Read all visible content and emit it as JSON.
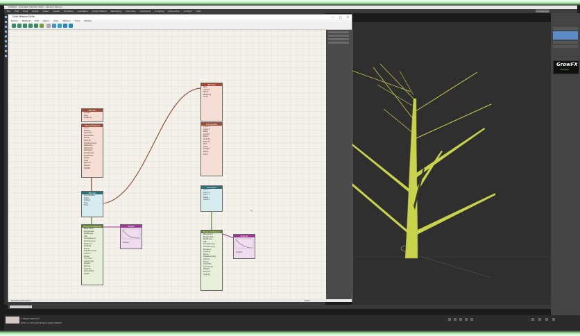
{
  "app": {
    "title": "Untitled - Autodesk 3ds Max 2021 - Student Version",
    "menus": [
      "File",
      "Edit",
      "Tools",
      "Group",
      "Views",
      "Create",
      "Modifiers",
      "Animation",
      "Graph Editors",
      "Rendering",
      "Civil View",
      "Customize",
      "Scripting",
      "Interactive",
      "Content",
      "Help"
    ],
    "workspace": "Workspaces"
  },
  "sme": {
    "title": "Slate Material Editor",
    "menus": [
      "Modes",
      "Material",
      "Edit",
      "Select",
      "View",
      "Options",
      "Tools",
      "Utilities"
    ],
    "status": "Rendering finished",
    "zoom": "100%",
    "nodes": [
      {
        "id": "n1",
        "title": "Bitmap",
        "rows": [
          "Output",
          "Map",
          "Mapping",
          "Noise"
        ]
      },
      {
        "id": "n2",
        "title": "Wood Material",
        "rows": [
          "Color",
          "Diffuse",
          "Specular",
          "Glossiness",
          "Bump",
          "Opacity",
          "Displacement",
          "Reflection",
          "Refraction",
          "Self-Illum",
          "Roughness",
          "Metalness",
          "Sheen",
          "Coat",
          "Normal",
          "Height",
          "Weight"
        ]
      },
      {
        "id": "n3",
        "title": "Bitmap",
        "rows": [
          "Coordinates",
          "Noise",
          "Output",
          "Map",
          "Time"
        ]
      },
      {
        "id": "n4",
        "title": "Falloff",
        "rows": [
          "Front",
          "Side",
          "Output",
          "Mix Curve"
        ]
      },
      {
        "id": "n5",
        "title": "Physical Material",
        "rows": [
          "Base Color",
          "Roughness",
          "Metalness",
          "IOR",
          "Transparency",
          "Translucency",
          "Emission",
          "Coating",
          "Bump",
          "Displacement",
          "Cutout",
          "Sheen",
          "Thin Film",
          "Anisotropy",
          "Weight",
          "Normal",
          "Opacity",
          "Subsurface",
          "Depth"
        ]
      },
      {
        "id": "n6",
        "title": "Gradient",
        "rows": [
          "Color 1",
          "Color 2",
          "Color 3",
          "Noise",
          "Output"
        ]
      },
      {
        "id": "n7",
        "title": "Output",
        "rows": [
          "Curve",
          "Output",
          "Map"
        ]
      },
      {
        "id": "n8",
        "title": "Composite",
        "rows": [
          "Layer 1",
          "Layer 2",
          "Mask",
          "Output",
          "Blend",
          "Opacity",
          "Normal",
          "Tint",
          "Glow",
          "Weight",
          "Noise",
          "Color"
        ]
      },
      {
        "id": "n9",
        "title": "Bitmap",
        "rows": [
          "Map",
          "Output",
          "Noise",
          "Mapping",
          "Time"
        ]
      }
    ]
  },
  "plugin": {
    "name": "GrowFX",
    "sub": "ExLevel"
  },
  "timeline": {
    "frame": "0 / 100"
  },
  "status": {
    "prompt1": "1 Object Selected",
    "prompt2": "Click or click-and-drag to select objects"
  },
  "colors": {
    "accent_glow": "#a8f0a8",
    "tree_fill": "#c8d24a",
    "node_red": "#a54a34",
    "node_teal": "#2e6f76",
    "node_green": "#5c7a2d",
    "node_purple": "#9a3a94"
  },
  "icons": [
    "close-icon",
    "minimize-icon",
    "maximize-icon",
    "mouse-cursor-icon"
  ]
}
